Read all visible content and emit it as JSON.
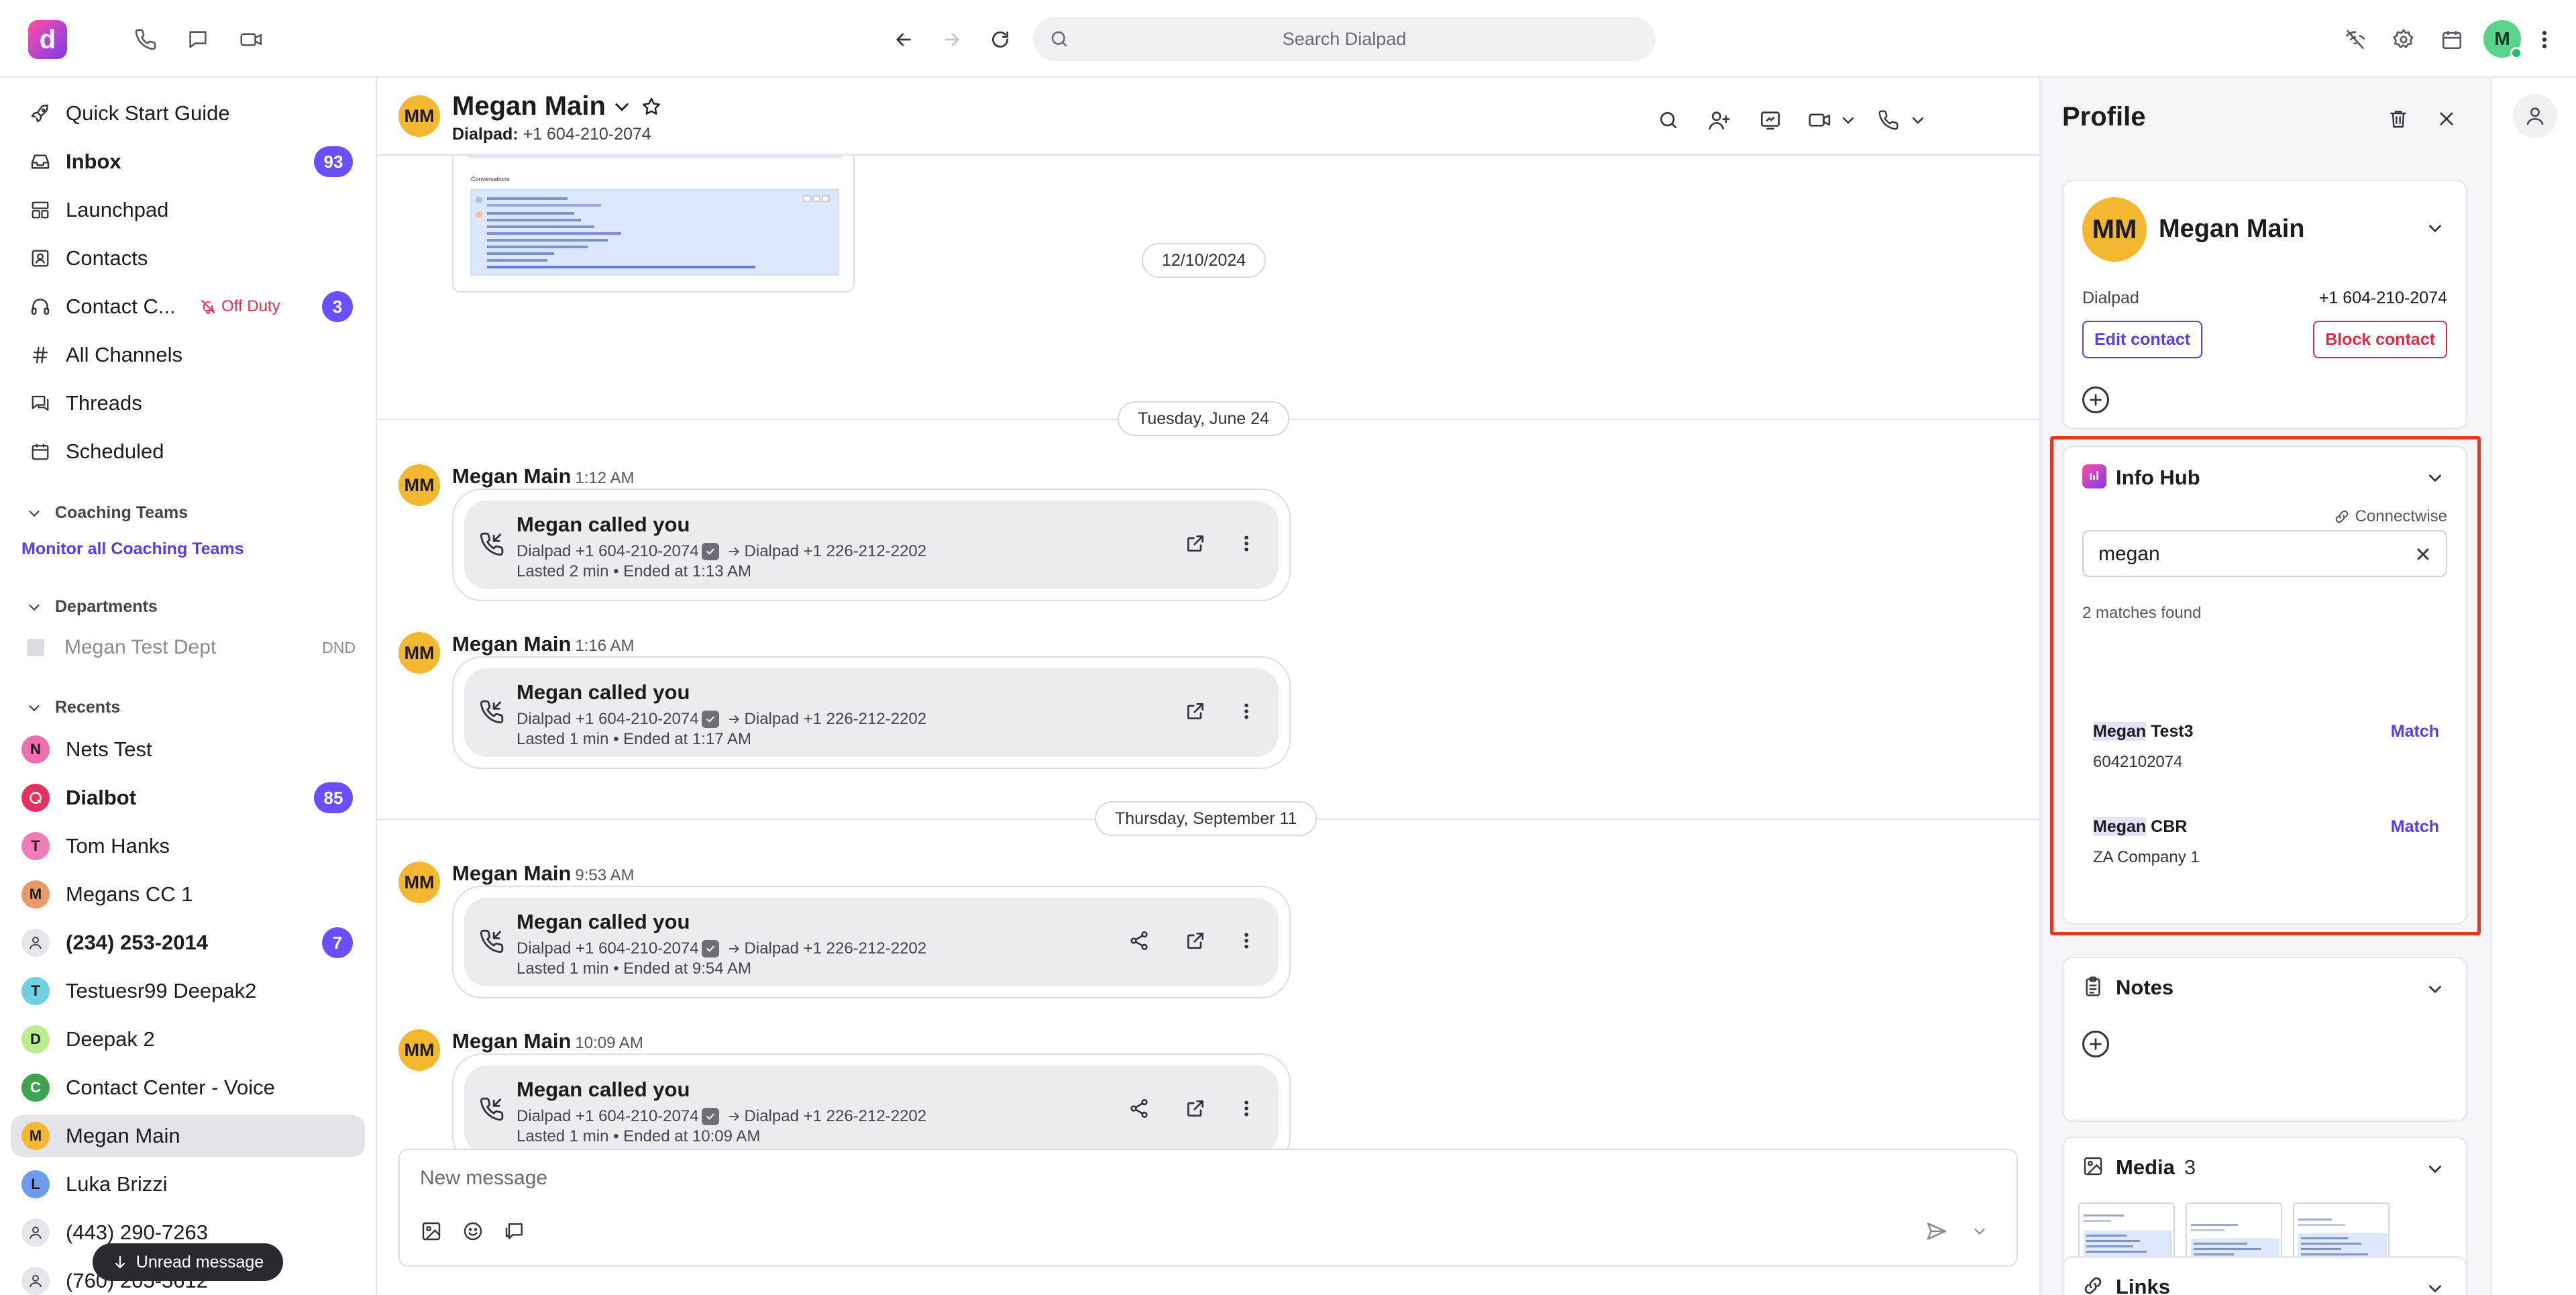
{
  "topbar": {
    "search_placeholder": "Search Dialpad",
    "logo_letter": "d",
    "user_initial": "M"
  },
  "sidebar": {
    "nav": [
      {
        "label": "Quick Start Guide",
        "icon": "rocket-icon"
      },
      {
        "label": "Inbox",
        "icon": "inbox-icon",
        "badge": "93"
      },
      {
        "label": "Launchpad",
        "icon": "launchpad-icon"
      },
      {
        "label": "Contacts",
        "icon": "contacts-icon"
      },
      {
        "label": "Contact C...",
        "icon": "headset-icon",
        "status": "Off Duty",
        "badge": "3"
      },
      {
        "label": "All Channels",
        "icon": "hash-icon"
      },
      {
        "label": "Threads",
        "icon": "threads-icon"
      },
      {
        "label": "Scheduled",
        "icon": "calendar-icon"
      }
    ],
    "coaching": {
      "title": "Coaching Teams",
      "link": "Monitor all Coaching Teams"
    },
    "departments": {
      "title": "Departments",
      "item": "Megan Test Dept",
      "item_status": "DND"
    },
    "recents": {
      "title": "Recents",
      "items": [
        {
          "label": "Nets Test",
          "initial": "N",
          "color": "#f06fb0"
        },
        {
          "label": "Dialbot",
          "initial": "",
          "color": "#e4325f",
          "badge": "85"
        },
        {
          "label": "Tom Hanks",
          "initial": "T",
          "color": "#f27cb6"
        },
        {
          "label": "Megans CC 1",
          "initial": "M",
          "color": "#e89a6a"
        },
        {
          "label": "(234) 253-2014",
          "initial": "",
          "color": "#e6e6ea",
          "badge": "7"
        },
        {
          "label": "Testuesr99 Deepak2",
          "initial": "T",
          "color": "#6fd0e2"
        },
        {
          "label": "Deepak 2",
          "initial": "D",
          "color": "#b7ef8f"
        },
        {
          "label": "Contact Center - Voice",
          "initial": "C",
          "color": "#3fa24f"
        },
        {
          "label": "Megan Main",
          "initial": "M",
          "color": "#f3b731"
        },
        {
          "label": "Luka Brizzi",
          "initial": "L",
          "color": "#6e9bf2"
        },
        {
          "label": "(443) 290-7263",
          "initial": "",
          "color": "#e6e6ea"
        },
        {
          "label": "(760) 205-5612",
          "initial": "",
          "color": "#e6e6ea"
        }
      ]
    },
    "unread_pill": "Unread message"
  },
  "conversation": {
    "contact_name": "Megan Main",
    "initials": "MM",
    "sub_label": "Dialpad:",
    "sub_phone": "+1 604-210-2074",
    "date_seps": [
      "12/10/2024",
      "Tuesday, June 24",
      "Thursday, September 11"
    ],
    "messages": [
      {
        "sender": "Megan Main",
        "time": "1:12 AM",
        "title": "Megan called you",
        "from": "Dialpad +1 604-210-2074",
        "to": "Dialpad +1 226-212-2202",
        "meta": "Lasted 2 min • Ended at 1:13 AM"
      },
      {
        "sender": "Megan Main",
        "time": "1:16 AM",
        "title": "Megan called you",
        "from": "Dialpad +1 604-210-2074",
        "to": "Dialpad +1 226-212-2202",
        "meta": "Lasted 1 min • Ended at 1:17 AM"
      },
      {
        "sender": "Megan Main",
        "time": "9:53 AM",
        "title": "Megan called you",
        "from": "Dialpad +1 604-210-2074",
        "to": "Dialpad +1 226-212-2202",
        "meta": "Lasted 1 min • Ended at 9:54 AM"
      },
      {
        "sender": "Megan Main",
        "time": "10:09 AM",
        "title": "Megan called you",
        "from": "Dialpad +1 604-210-2074",
        "to": "Dialpad +1 226-212-2202",
        "meta": "Lasted 1 min • Ended at 10:09 AM"
      }
    ],
    "attachment": {
      "heading": "Conversations"
    },
    "composer_placeholder": "New message"
  },
  "profile": {
    "title": "Profile",
    "contact_name": "Megan Main",
    "initials": "MM",
    "source": "Dialpad",
    "phone": "+1 604-210-2074",
    "edit_label": "Edit contact",
    "block_label": "Block contact",
    "info_hub": {
      "title": "Info Hub",
      "connector": "Connectwise",
      "search_value": "megan",
      "count_text": "2 matches found",
      "matches": [
        {
          "name_highlight": "Megan",
          "name_rest": " Test3",
          "sub": "6042102074",
          "action": "Match"
        },
        {
          "name_highlight": "Megan",
          "name_rest": " CBR",
          "sub": "ZA Company 1",
          "action": "Match"
        }
      ]
    },
    "notes_title": "Notes",
    "media_title": "Media",
    "media_count": "3",
    "links_title": "Links"
  },
  "colors": {
    "accent": "#5a3df0",
    "badge": "#6b4eff",
    "danger": "#d92e4a",
    "avatar_mm": "#f3b731",
    "highlight_box": "#e03a23"
  }
}
